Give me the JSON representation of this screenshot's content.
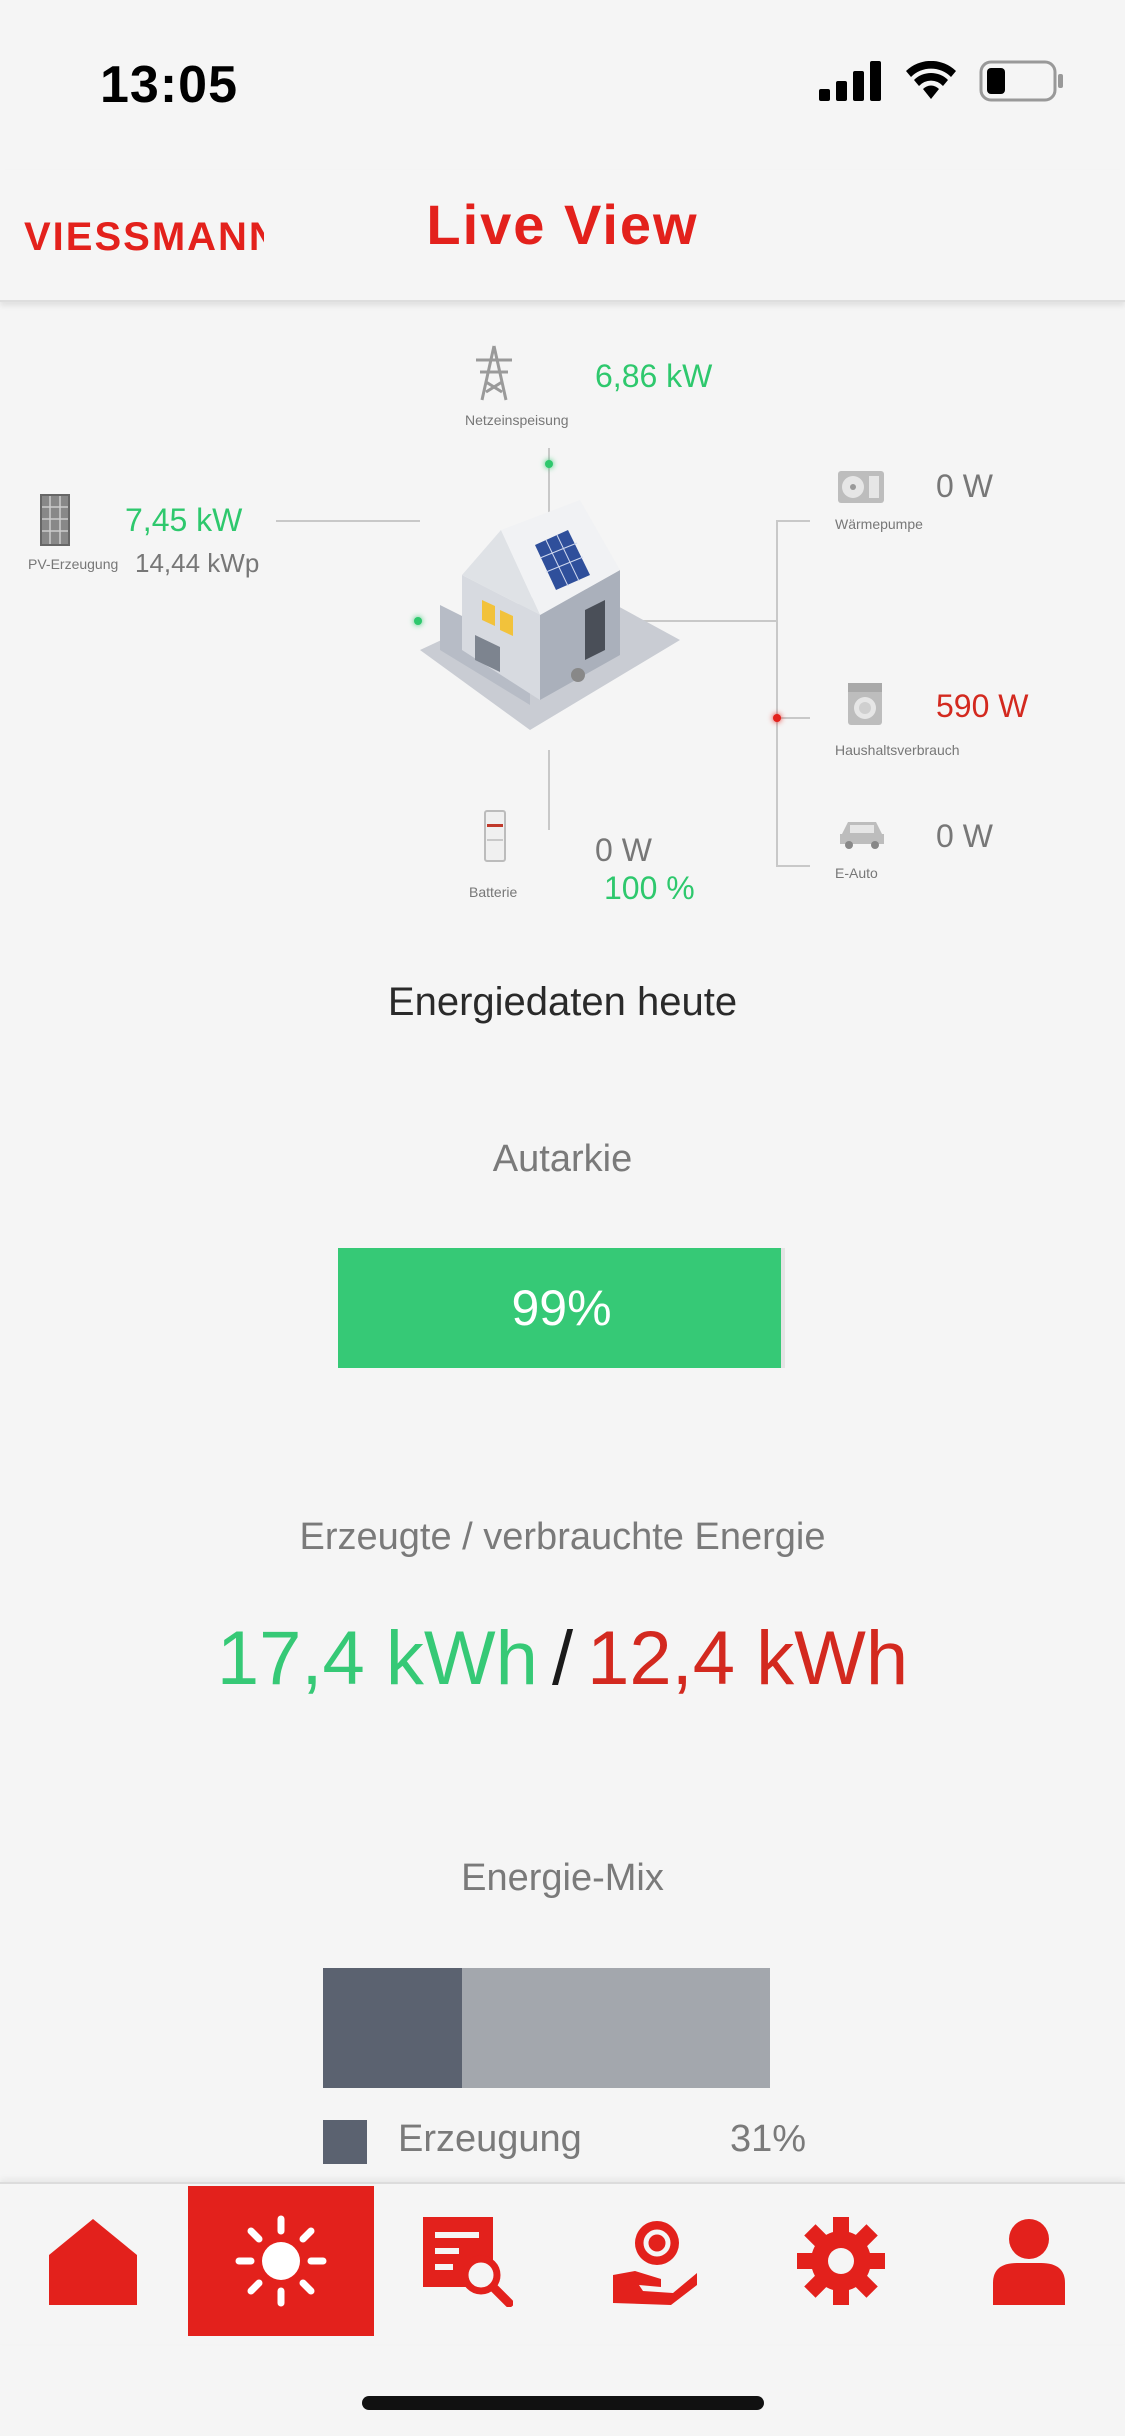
{
  "status_bar": {
    "time": "13:05",
    "icons": [
      "cellular-signal-icon",
      "wifi-icon",
      "battery-icon"
    ]
  },
  "header": {
    "logo_text": "VIESSMANN",
    "title": "Live View"
  },
  "diagram": {
    "grid": {
      "label": "Netzeinspeisung",
      "value": "6,86 kW"
    },
    "pv": {
      "label": "PV-Erzeugung",
      "value": "7,45 kW",
      "peak": "14,44 kWp"
    },
    "heatpump": {
      "label": "Wärmepumpe",
      "value": "0 W"
    },
    "household": {
      "label": "Haushaltsverbrauch",
      "value": "590 W"
    },
    "ecar": {
      "label": "E-Auto",
      "value": "0 W"
    },
    "battery": {
      "label": "Batterie",
      "value": "0 W",
      "soc": "100 %"
    }
  },
  "energy_today": {
    "title": "Energiedaten heute",
    "autarkie": {
      "label": "Autarkie",
      "value_text": "99%",
      "fraction": 0.99
    },
    "energy": {
      "label": "Erzeugte / verbrauchte Energie",
      "produced": "17,4 kWh",
      "separator": "/",
      "consumed": "12,4 kWh"
    },
    "mix": {
      "label": "Energie-Mix",
      "segments": [
        {
          "name": "Erzeugung",
          "fraction": 0.31,
          "color": "#5b6270"
        },
        {
          "fraction": 0.69,
          "color": "#a3a7ad"
        }
      ],
      "legend": [
        {
          "label": "Erzeugung",
          "value": "31%"
        }
      ]
    }
  },
  "bottom_nav": {
    "items": [
      {
        "icon": "home-icon",
        "active": false
      },
      {
        "icon": "sun-icon",
        "active": true
      },
      {
        "icon": "search-report-icon",
        "active": false
      },
      {
        "icon": "hand-coin-icon",
        "active": false
      },
      {
        "icon": "gear-icon",
        "active": false
      },
      {
        "icon": "user-icon",
        "active": false
      }
    ]
  },
  "colors": {
    "brand_red": "#e3211c",
    "positive_green": "#2ec86d",
    "negative_red": "#d3291f",
    "muted_grey": "#777777"
  }
}
